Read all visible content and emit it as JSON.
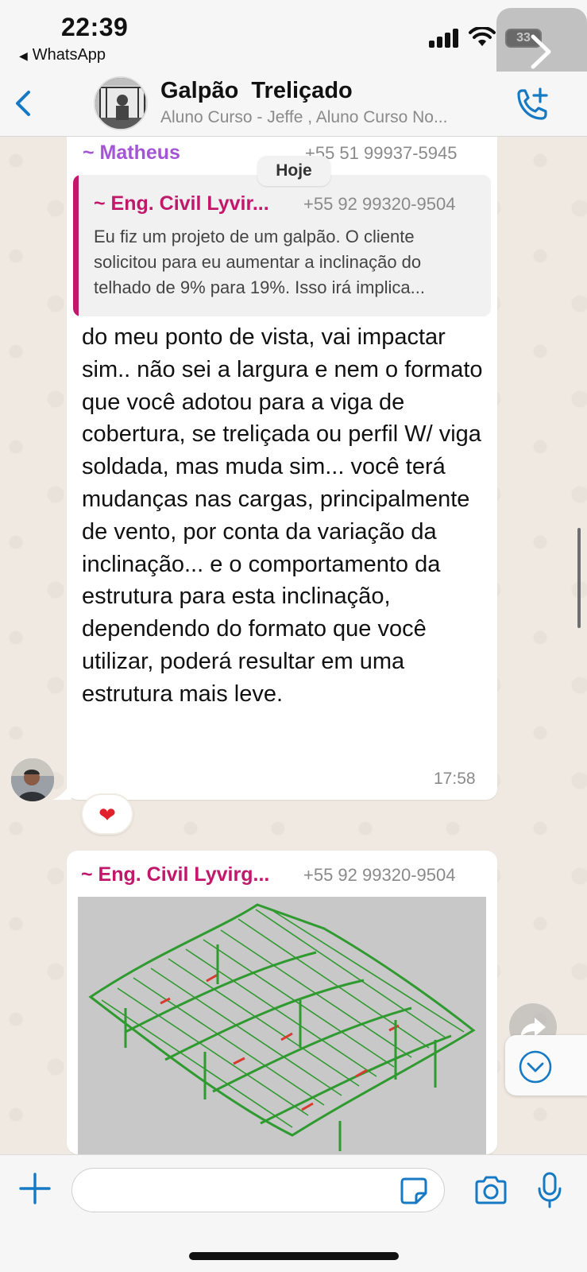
{
  "status_bar": {
    "time": "22:39",
    "back_app_label": "WhatsApp",
    "battery": "33"
  },
  "header": {
    "title": "Galpão  Treliçado",
    "subtitle": "Aluno Curso - Jeffe , Aluno Curso No..."
  },
  "date_chip": "Hoje",
  "messages": [
    {
      "sender": "~ Matheus",
      "sender_phone": "+55 51 99937-5945",
      "quoted": {
        "sender": "~ Eng. Civil Lyvir...",
        "phone": "+55 92 99320-9504",
        "text": "Eu fiz um projeto de um galpão. O cliente solicitou para eu aumentar a inclinação do telhado de 9% para 19%. Isso irá implica..."
      },
      "text": "do meu ponto de vista, vai impactar sim.. não sei a largura e nem o formato que você adotou para a viga de cobertura, se treliçada ou perfil W/ viga soldada, mas muda sim... você terá mudanças nas cargas, principalmente de vento, por conta da variação da inclinação... e o comportamento da estrutura para esta inclinação, dependendo do formato que você utilizar, poderá resultar em uma estrutura mais leve.",
      "time": "17:58",
      "reaction": "❤"
    },
    {
      "sender": "~ Eng. Civil Lyvirg...",
      "sender_phone": "+55 92 99320-9504",
      "attachment": "image"
    }
  ],
  "composer": {
    "placeholder": ""
  },
  "icons": {
    "back": "chevron-left-icon",
    "add_call": "phone-plus-icon",
    "plus": "plus-icon",
    "sticker": "sticker-icon",
    "camera": "camera-icon",
    "mic": "microphone-icon",
    "forward": "forward-icon",
    "scroll_down": "chevron-down-circle-icon"
  },
  "colors": {
    "accent_blue": "#1679c4",
    "sender_purple": "#a455d6",
    "sender_magenta": "#c2186b",
    "chat_background": "#efeae2",
    "structure_green": "#2f9a2f"
  }
}
